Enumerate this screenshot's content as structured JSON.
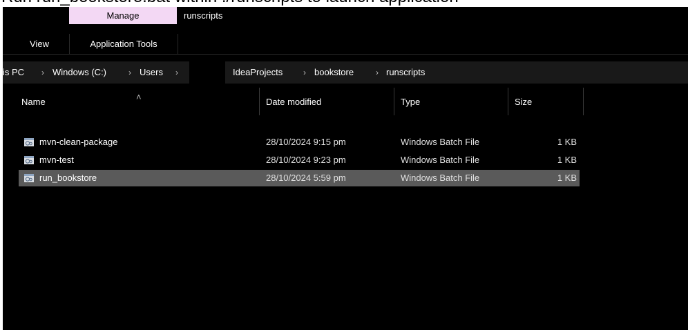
{
  "caption": "Run run_bookstore.bat within ./runscripts to launch application",
  "ribbon": {
    "context_group": "Manage",
    "context_title": "runscripts",
    "tabs": [
      {
        "label": "View"
      },
      {
        "label": "Application Tools"
      }
    ]
  },
  "address": {
    "crumbs": [
      "is PC",
      "Windows (C:)",
      "Users",
      "IdeaProjects",
      "bookstore",
      "runscripts"
    ]
  },
  "list": {
    "columns": {
      "name": "Name",
      "date": "Date modified",
      "type": "Type",
      "size": "Size"
    },
    "rows": [
      {
        "name": "mvn-clean-package",
        "date": "28/10/2024 9:15 pm",
        "type": "Windows Batch File",
        "size": "1 KB",
        "selected": false
      },
      {
        "name": "mvn-test",
        "date": "28/10/2024 9:23 pm",
        "type": "Windows Batch File",
        "size": "1 KB",
        "selected": false
      },
      {
        "name": "run_bookstore",
        "date": "28/10/2024 5:59 pm",
        "type": "Windows Batch File",
        "size": "1 KB",
        "selected": true
      }
    ]
  },
  "icons": {
    "file": "batch-file-icon",
    "sort": "sort-ascending-icon",
    "separator": "chevron-right-icon"
  }
}
